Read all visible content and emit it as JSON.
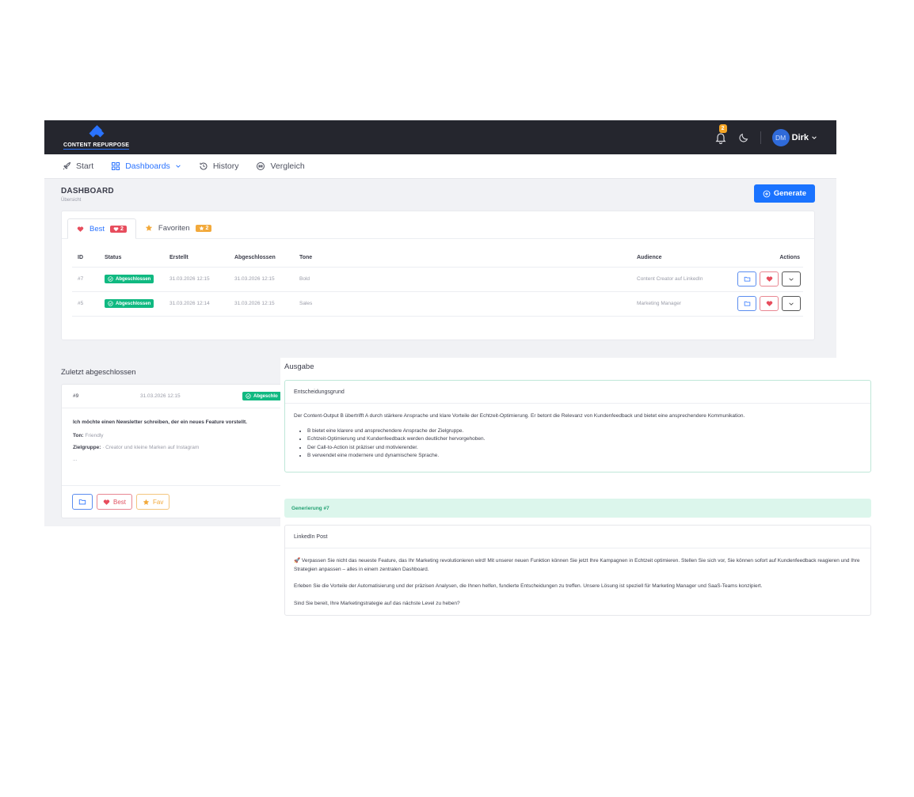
{
  "brand": {
    "logo_text": "CONTENT REPURPOSE"
  },
  "topbar": {
    "notification_count": "2",
    "user_initials": "DM",
    "user_name": "Dirk"
  },
  "nav": [
    {
      "label": "Start",
      "icon": "rocket-icon"
    },
    {
      "label": "Dashboards",
      "icon": "grid-icon",
      "active": true
    },
    {
      "label": "History",
      "icon": "history-icon"
    },
    {
      "label": "Vergleich",
      "icon": "compare-icon"
    }
  ],
  "page": {
    "title": "DASHBOARD",
    "subtitle": "Übersicht",
    "generate_label": "Generate"
  },
  "tabs": [
    {
      "label": "Best",
      "count": "2"
    },
    {
      "label": "Favoriten",
      "count": "2"
    }
  ],
  "table": {
    "headers": {
      "id": "ID",
      "status": "Status",
      "created": "Erstellt",
      "completed": "Abgeschlossen",
      "tone": "Tone",
      "audience": "Audience",
      "actions": "Actions"
    },
    "rows": [
      {
        "id": "#7",
        "status": "Abgeschlossen",
        "created": "31.03.2026 12:15",
        "completed": "31.03.2026 12:15",
        "tone": "Bold",
        "audience": "Content Creator auf LinkedIn"
      },
      {
        "id": "#5",
        "status": "Abgeschlossen",
        "created": "31.03.2026 12:14",
        "completed": "31.03.2026 12:15",
        "tone": "Sales",
        "audience": "Marketing Manager"
      }
    ]
  },
  "recent": {
    "title": "Zuletzt abgeschlossen",
    "id": "#9",
    "date": "31.03.2026 12:15",
    "status": "Abgeschlo",
    "prompt": "Ich möchte einen Newsletter schreiben, der ein neues Feature vorstellt.",
    "tone_label": "Ton:",
    "tone_value": "Friendly",
    "audience_label": "Zielgruppe:",
    "audience_value": "· Creator und kleine Marken auf Instagram",
    "more": "...",
    "best_label": "Best",
    "fav_label": "Fav"
  },
  "output": {
    "title": "Ausgabe",
    "reason_title": "Entscheidungsgrund",
    "reason_text": "Der Content-Output B übertrifft A durch stärkere Ansprache und klare Vorteile der Echtzeit-Optimierung. Er betont die Relevanz von Kundenfeedback und bietet eine ansprechendere Kommunikation.",
    "bullets": [
      "B bietet eine klarere und ansprechendere Ansprache der Zielgruppe.",
      "Echtzeit-Optimierung und Kundenfeedback werden deutlicher hervorgehoben.",
      "Der Call-to-Action ist präziser und motivierender.",
      "B verwendet eine modernere und dynamischere Sprache."
    ],
    "generation_label": "Generierung #7",
    "post_title": "LinkedIn Post",
    "post_paragraphs": [
      "🚀 Verpassen Sie nicht das neueste Feature, das Ihr Marketing revolutionieren wird! Mit unserer neuen Funktion können Sie jetzt Ihre Kampagnen in Echtzeit optimieren. Stellen Sie sich vor, Sie können sofort auf Kundenfeedback reagieren und Ihre Strategien anpassen – alles in einem zentralen Dashboard.",
      "Erleben Sie die Vorteile der Automatisierung und der präzisen Analysen, die Ihnen helfen, fundierte Entscheidungen zu treffen. Unsere Lösung ist speziell für Marketing Manager und SaaS-Teams konzipiert.",
      "Sind Sie bereit, Ihre Marketingstrategie auf das nächste Level zu heben?"
    ]
  },
  "colors": {
    "accent": "#1a73ff",
    "success": "#10b981",
    "danger": "#e74d5d",
    "warning": "#f2a93b",
    "topbar": "#25262e"
  }
}
